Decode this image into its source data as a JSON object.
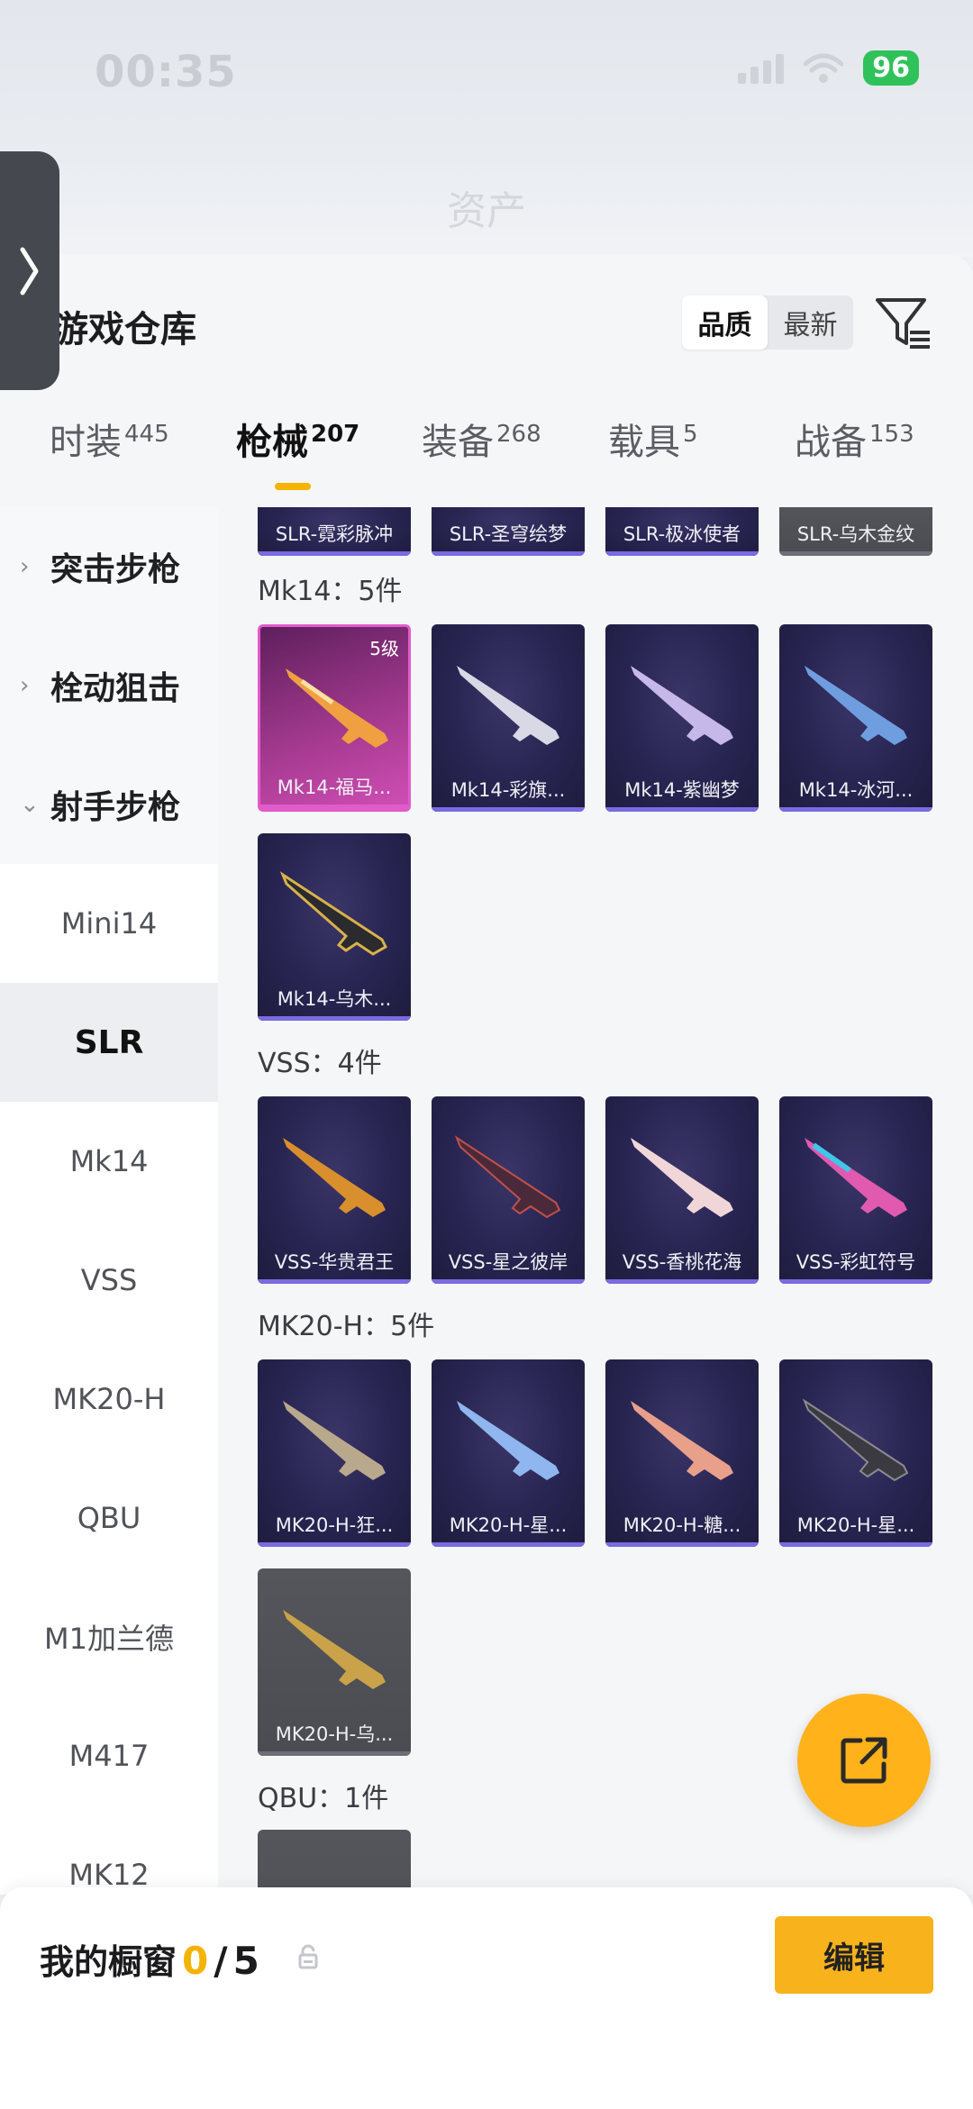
{
  "status_bar": {
    "time": "00:35",
    "battery": "96"
  },
  "header": {
    "title": "资产"
  },
  "panel": {
    "title": "游戏仓库",
    "sort_options": [
      "品质",
      "最新"
    ],
    "sort_selected": "品质"
  },
  "category_tabs": [
    {
      "label": "时装",
      "count": "445"
    },
    {
      "label": "枪械",
      "count": "207",
      "active": true
    },
    {
      "label": "装备",
      "count": "268"
    },
    {
      "label": "载具",
      "count": "5"
    },
    {
      "label": "战备",
      "count": "153"
    }
  ],
  "subnav": {
    "groups": [
      "突击步枪",
      "栓动狙击",
      "射手步枪"
    ],
    "items": [
      "Mini14",
      "SLR",
      "Mk14",
      "VSS",
      "MK20-H",
      "QBU",
      "M1加兰德",
      "M417",
      "MK12"
    ],
    "selected": "SLR"
  },
  "sections": {
    "slr_partial": [
      "SLR-霓彩脉冲",
      "SLR-圣穹绘梦",
      "SLR-极冰使者",
      "SLR-乌木金纹"
    ],
    "mk14": {
      "label": "Mk14：5件",
      "items": [
        "Mk14-福马...",
        "Mk14-彩旗...",
        "Mk14-紫幽梦",
        "Mk14-冰河...",
        "Mk14-乌木..."
      ],
      "first_level": "5级"
    },
    "vss": {
      "label": "VSS：4件",
      "items": [
        "VSS-华贵君王",
        "VSS-星之彼岸",
        "VSS-香桃花海",
        "VSS-彩虹符号"
      ]
    },
    "mk20h": {
      "label": "MK20-H：5件",
      "items": [
        "MK20-H-狂...",
        "MK20-H-星...",
        "MK20-H-糖...",
        "MK20-H-星...",
        "MK20-H-乌..."
      ]
    },
    "qbu": {
      "label": "QBU：1件"
    }
  },
  "bottom_bar": {
    "label": "我的橱窗",
    "used": "0",
    "slash": "/",
    "total": "5",
    "edit_label": "编辑"
  },
  "colors": {
    "accent": "#f7b21c",
    "card_bg": "#272451",
    "pink_card": "#d04fb5"
  }
}
